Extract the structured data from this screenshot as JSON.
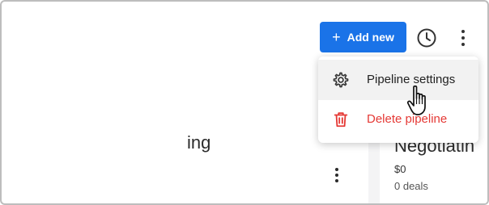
{
  "toolbar": {
    "add_new_label": "Add new",
    "add_new_icon": "plus-icon",
    "history_icon": "clock-icon",
    "more_icon": "more-vertical-icon"
  },
  "menu": {
    "items": [
      {
        "label": "Pipeline settings",
        "icon": "gear-icon"
      },
      {
        "label": "Delete pipeline",
        "icon": "trash-icon",
        "color": "#e53935"
      }
    ]
  },
  "columns": [
    {
      "title": "ing"
    },
    {
      "title": "Negotiatin",
      "amount": "$0",
      "deals": "0 deals"
    }
  ],
  "colors": {
    "primary": "#1a73e8",
    "danger": "#e53935",
    "board_bg": "#f4f4f5"
  }
}
